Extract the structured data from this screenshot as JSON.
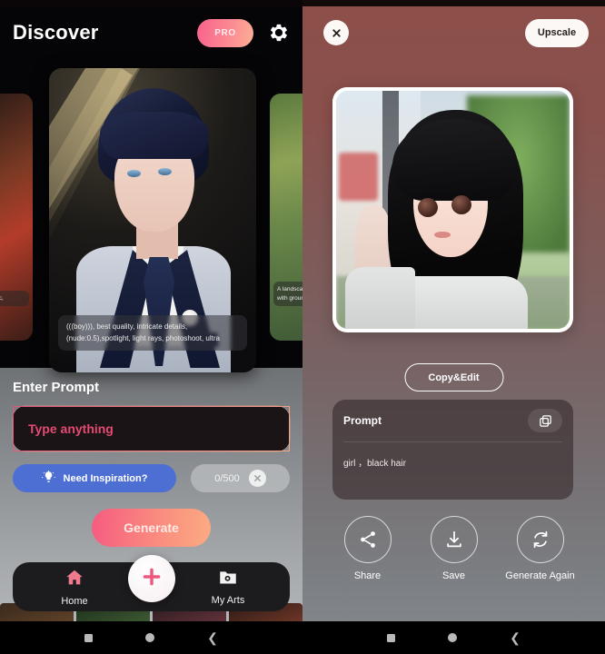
{
  "left": {
    "header": {
      "title": "Discover",
      "pro_label": "PRO",
      "settings_icon": "gear-icon"
    },
    "carousel": {
      "left_card_caption": "rl, ic,",
      "main_card_caption": "(((boy))), best quality, intricate details, (nude:0.5),spotlight, light rays, photoshoot, ultra",
      "right_card_caption": "A landscape with ground"
    },
    "prompt": {
      "section_title": "Enter Prompt",
      "input_value": "",
      "input_placeholder": "Type anything",
      "inspiration_label": "Need Inspiration?",
      "inspiration_icon": "lightbulb-icon",
      "counter_label": "0/500",
      "clear_icon": "close-circle-icon",
      "generate_label": "Generate"
    },
    "nav": {
      "home_label": "Home",
      "home_icon": "home-icon",
      "create_icon": "plus-icon",
      "arts_label": "My Arts",
      "arts_icon": "folder-image-icon"
    }
  },
  "right": {
    "header": {
      "close_icon": "close-icon",
      "upscale_label": "Upscale"
    },
    "copy_edit_label": "Copy&Edit",
    "prompt_card": {
      "title": "Prompt",
      "copy_icon": "copy-icon",
      "text": "girl ，black hair"
    },
    "actions": [
      {
        "label": "Share",
        "icon": "share-icon"
      },
      {
        "label": "Save",
        "icon": "download-icon"
      },
      {
        "label": "Generate Again",
        "icon": "refresh-icon"
      }
    ]
  },
  "system": {
    "recents_icon": "square-icon",
    "home_icon": "circle-icon",
    "back_icon": "chevron-left-icon"
  },
  "colors": {
    "accent_pink": "#f6437a",
    "pro_gradient_start": "#f8618d",
    "pro_gradient_end": "#fdb096",
    "inspiration_blue": "#4d6fd4",
    "panel_dark": "#050406",
    "right_top": "#8c4f4a"
  }
}
